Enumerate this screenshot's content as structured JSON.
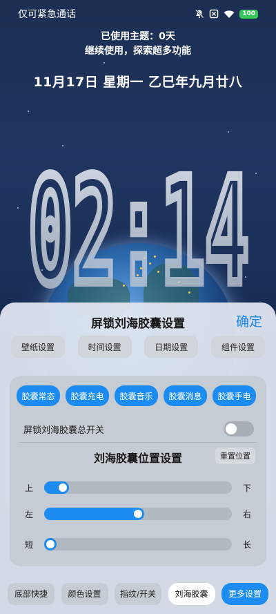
{
  "status_bar": {
    "carrier_text": "仅可紧急通话",
    "icons": [
      "bell-muted-icon",
      "sim-blocked-icon",
      "wifi-icon"
    ],
    "battery": "100",
    "battery_color": "#35c759"
  },
  "notice": {
    "line1": "已使用主题：0天",
    "line2": "继续使用，探索超多功能"
  },
  "date_line": "11月17日 星期一 乙巳年九月廿八",
  "clock": {
    "time": "02:14"
  },
  "sheet": {
    "title": "屏锁刘海胶囊设置",
    "confirm_label": "确定",
    "top_tabs": [
      "壁纸设置",
      "时间设置",
      "日期设置",
      "组件设置"
    ],
    "capsule_tabs": [
      "胶囊常态",
      "胶囊充电",
      "胶囊音乐",
      "胶囊消息",
      "胶囊手电"
    ],
    "master_switch": {
      "label": "屏锁刘海胶囊总开关",
      "on": false
    },
    "position": {
      "title": "刘海胶囊位置设置",
      "reset_label": "重置位置",
      "sliders": [
        {
          "left_label": "上",
          "right_label": "下",
          "value": 0.1
        },
        {
          "left_label": "左",
          "right_label": "右",
          "value": 0.5
        },
        {
          "left_label": "短",
          "right_label": "长",
          "value": 0.03
        }
      ]
    },
    "bottom_tabs": [
      {
        "label": "底部快捷",
        "state": "normal"
      },
      {
        "label": "颜色设置",
        "state": "normal"
      },
      {
        "label": "指纹/开关",
        "state": "normal"
      },
      {
        "label": "刘海胶囊",
        "state": "active"
      },
      {
        "label": "更多设置",
        "state": "primary"
      }
    ]
  },
  "colors": {
    "accent": "#1d8cf0",
    "confirm": "#1e88e5"
  }
}
